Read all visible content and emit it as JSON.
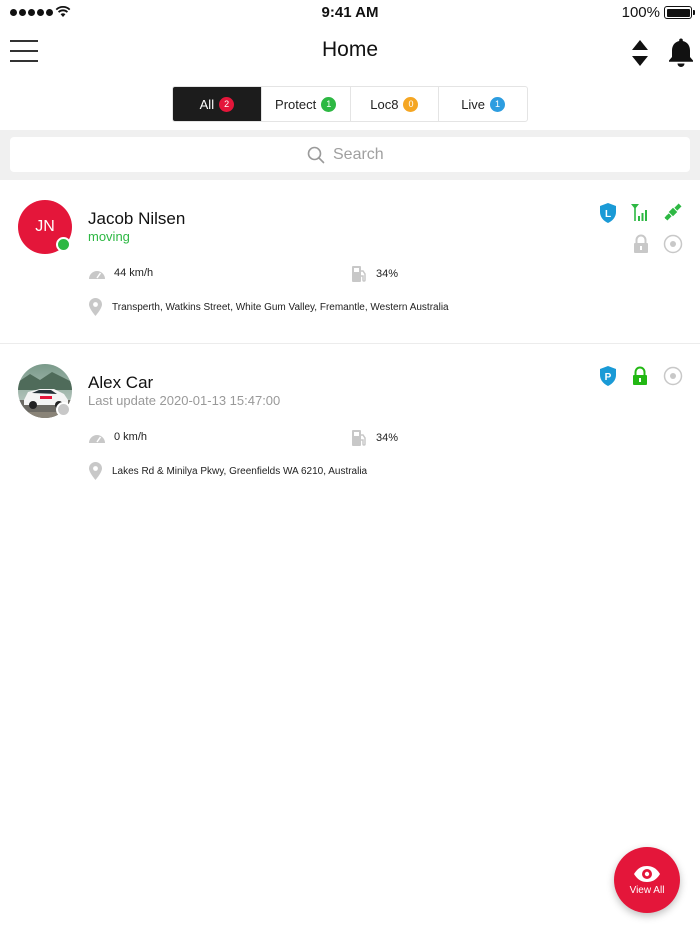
{
  "status_bar": {
    "time": "9:41 AM",
    "battery": "100%"
  },
  "header": {
    "title": "Home"
  },
  "tabs": [
    {
      "label": "All",
      "count": "2",
      "color": "#e4163a",
      "active": true
    },
    {
      "label": "Protect",
      "count": "1",
      "color": "#2db843",
      "active": false
    },
    {
      "label": "Loc8",
      "count": "0",
      "color": "#f5a623",
      "active": false
    },
    {
      "label": "Live",
      "count": "1",
      "color": "#2d9de0",
      "active": false
    }
  ],
  "search": {
    "placeholder": "Search"
  },
  "vehicles": [
    {
      "initials": "JN",
      "name": "Jacob Nilsen",
      "status": "moving",
      "status_color": "#2db843",
      "speed": "44 km/h",
      "fuel": "34%",
      "address": "Transperth, Watkins Street, White Gum Valley, Fremantle, Western Australia",
      "shield_letter": "L",
      "icons": [
        "shield-l-icon",
        "signal-icon",
        "satellite-icon",
        "lock-icon",
        "target-icon"
      ]
    },
    {
      "name": "Alex Car",
      "status": "Last update 2020-01-13 15:47:00",
      "status_color": "#999999",
      "speed": "0 km/h",
      "fuel": "34%",
      "address": "Lakes Rd & Minilya Pkwy, Greenfields WA 6210, Australia",
      "shield_letter": "P",
      "icons": [
        "shield-p-icon",
        "lock-icon",
        "target-icon"
      ]
    }
  ],
  "fab": {
    "label": "View All",
    "icon": "eye-icon"
  },
  "colors": {
    "accent": "#e4163a",
    "green": "#2db843",
    "blue": "#1a9ad6",
    "grey_icon": "#c8c8c8"
  }
}
